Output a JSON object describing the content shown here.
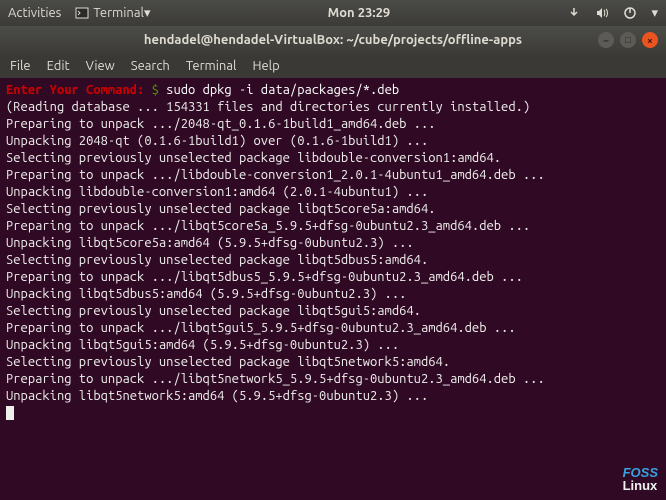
{
  "topbar": {
    "activities": "Activities",
    "app_label": "Terminal",
    "clock": "Mon 23:29"
  },
  "titlebar": {
    "title": "hendadel@hendadel-VirtualBox: ~/cube/projects/offline-apps"
  },
  "menubar": {
    "file": "File",
    "edit": "Edit",
    "view": "View",
    "search": "Search",
    "terminal": "Terminal",
    "help": "Help"
  },
  "terminal": {
    "prompt_label": "Enter Your Command:",
    "prompt_symbol": "$",
    "command": "sudo dpkg -i data/packages/*.deb",
    "lines": [
      "(Reading database ... 154331 files and directories currently installed.)",
      "Preparing to unpack .../2048-qt_0.1.6-1build1_amd64.deb ...",
      "Unpacking 2048-qt (0.1.6-1build1) over (0.1.6-1build1) ...",
      "Selecting previously unselected package libdouble-conversion1:amd64.",
      "Preparing to unpack .../libdouble-conversion1_2.0.1-4ubuntu1_amd64.deb ...",
      "Unpacking libdouble-conversion1:amd64 (2.0.1-4ubuntu1) ...",
      "Selecting previously unselected package libqt5core5a:amd64.",
      "Preparing to unpack .../libqt5core5a_5.9.5+dfsg-0ubuntu2.3_amd64.deb ...",
      "Unpacking libqt5core5a:amd64 (5.9.5+dfsg-0ubuntu2.3) ...",
      "Selecting previously unselected package libqt5dbus5:amd64.",
      "Preparing to unpack .../libqt5dbus5_5.9.5+dfsg-0ubuntu2.3_amd64.deb ...",
      "Unpacking libqt5dbus5:amd64 (5.9.5+dfsg-0ubuntu2.3) ...",
      "Selecting previously unselected package libqt5gui5:amd64.",
      "Preparing to unpack .../libqt5gui5_5.9.5+dfsg-0ubuntu2.3_amd64.deb ...",
      "Unpacking libqt5gui5:amd64 (5.9.5+dfsg-0ubuntu2.3) ...",
      "Selecting previously unselected package libqt5network5:amd64.",
      "Preparing to unpack .../libqt5network5_5.9.5+dfsg-0ubuntu2.3_amd64.deb ...",
      "Unpacking libqt5network5:amd64 (5.9.5+dfsg-0ubuntu2.3) ..."
    ]
  },
  "watermark": {
    "line1": "FOSS",
    "line2": "Linux"
  }
}
